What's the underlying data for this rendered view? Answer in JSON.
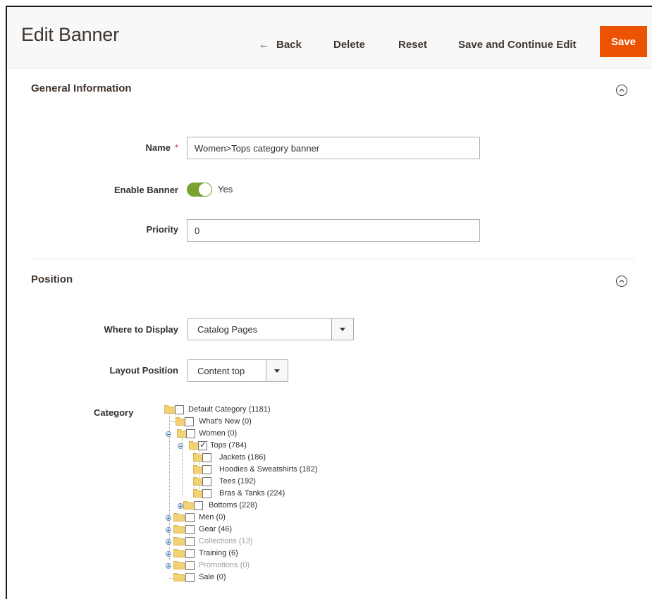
{
  "header": {
    "title": "Edit Banner",
    "back_label": "Back",
    "back_icon": "arrow-left-icon",
    "delete_label": "Delete",
    "reset_label": "Reset",
    "save_continue_label": "Save and Continue Edit",
    "save_label": "Save"
  },
  "general": {
    "title": "General Information",
    "name_label": "Name",
    "name_required": "*",
    "name_value": "Women>Tops category banner",
    "enable_label": "Enable Banner",
    "enable_value": "Yes",
    "enabled": true,
    "priority_label": "Priority",
    "priority_value": "0"
  },
  "position": {
    "title": "Position",
    "where_label": "Where to Display",
    "where_value": "Catalog Pages",
    "layout_label": "Layout Position",
    "layout_value": "Content top",
    "category_label": "Category"
  },
  "tree": [
    {
      "label": "Default Category (1181)",
      "checked": false,
      "disabled": false
    },
    {
      "label": "What's New (0)",
      "checked": false,
      "disabled": false
    },
    {
      "label": "Women (0)",
      "checked": false,
      "disabled": false
    },
    {
      "label": "Tops (784)",
      "checked": true,
      "disabled": false
    },
    {
      "label": "Jackets (186)",
      "checked": false,
      "disabled": false
    },
    {
      "label": "Hoodies & Sweatshirts (182)",
      "checked": false,
      "disabled": false
    },
    {
      "label": "Tees (192)",
      "checked": false,
      "disabled": false
    },
    {
      "label": "Bras & Tanks (224)",
      "checked": false,
      "disabled": false
    },
    {
      "label": "Bottoms (228)",
      "checked": false,
      "disabled": false
    },
    {
      "label": "Men (0)",
      "checked": false,
      "disabled": false
    },
    {
      "label": "Gear (46)",
      "checked": false,
      "disabled": false
    },
    {
      "label": "Collections (13)",
      "checked": false,
      "disabled": true
    },
    {
      "label": "Training (6)",
      "checked": false,
      "disabled": false
    },
    {
      "label": "Promotions (0)",
      "checked": false,
      "disabled": true
    },
    {
      "label": "Sale (0)",
      "checked": false,
      "disabled": false
    }
  ],
  "colors": {
    "accent": "#eb5202",
    "toggle_on": "#79a22e",
    "required": "#e22626"
  }
}
